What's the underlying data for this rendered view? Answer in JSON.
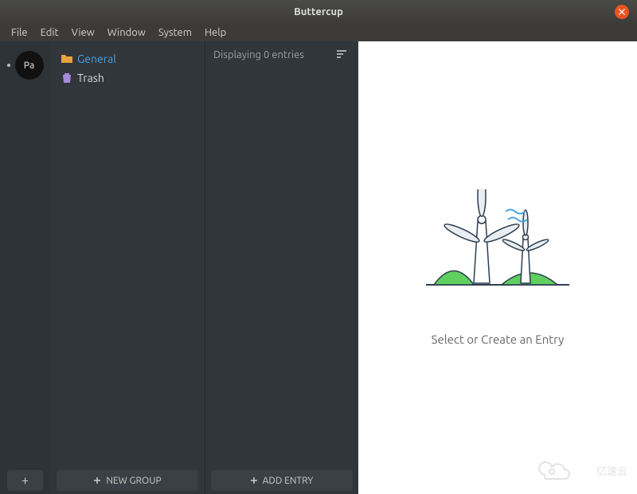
{
  "window": {
    "title": "Buttercup"
  },
  "menubar": {
    "items": [
      "File",
      "Edit",
      "View",
      "Window",
      "System",
      "Help"
    ]
  },
  "vaults": {
    "items": [
      {
        "abbrev": "Pa"
      }
    ]
  },
  "groups": {
    "items": [
      {
        "id": "general",
        "label": "General",
        "icon": "folder-icon",
        "color": "#e8a33d"
      },
      {
        "id": "trash",
        "label": "Trash",
        "icon": "trash-icon",
        "color": "#a78bd8"
      }
    ]
  },
  "entries": {
    "header": "Displaying 0 entries"
  },
  "detail": {
    "empty_message": "Select or Create an Entry"
  },
  "buttons": {
    "add_vault": "+",
    "new_group": "NEW GROUP",
    "add_entry": "ADD ENTRY"
  },
  "watermark": {
    "text": "亿速云"
  }
}
